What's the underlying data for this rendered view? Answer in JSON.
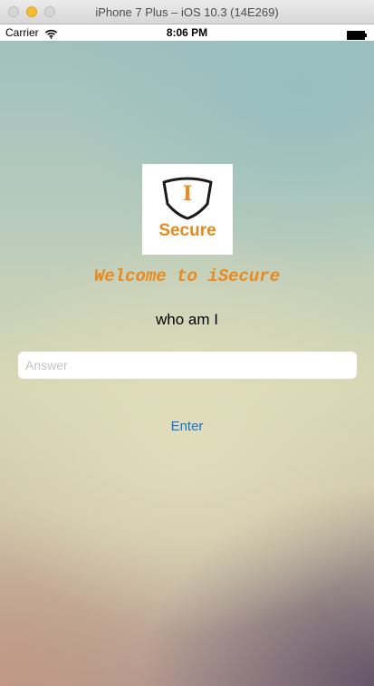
{
  "window": {
    "title": "iPhone 7 Plus – iOS 10.3 (14E269)"
  },
  "status_bar": {
    "carrier": "Carrier",
    "time": "8:06 PM",
    "icons": [
      "wifi-icon",
      "battery-icon"
    ]
  },
  "logo": {
    "letter": "I",
    "word": "Secure"
  },
  "welcome_text": "Welcome to iSecure",
  "question": "who am I",
  "answer_field": {
    "placeholder": "Answer",
    "value": ""
  },
  "enter_button": {
    "label": "Enter"
  },
  "colors": {
    "accent_orange": "#e9891e",
    "link_blue": "#1472d6"
  }
}
